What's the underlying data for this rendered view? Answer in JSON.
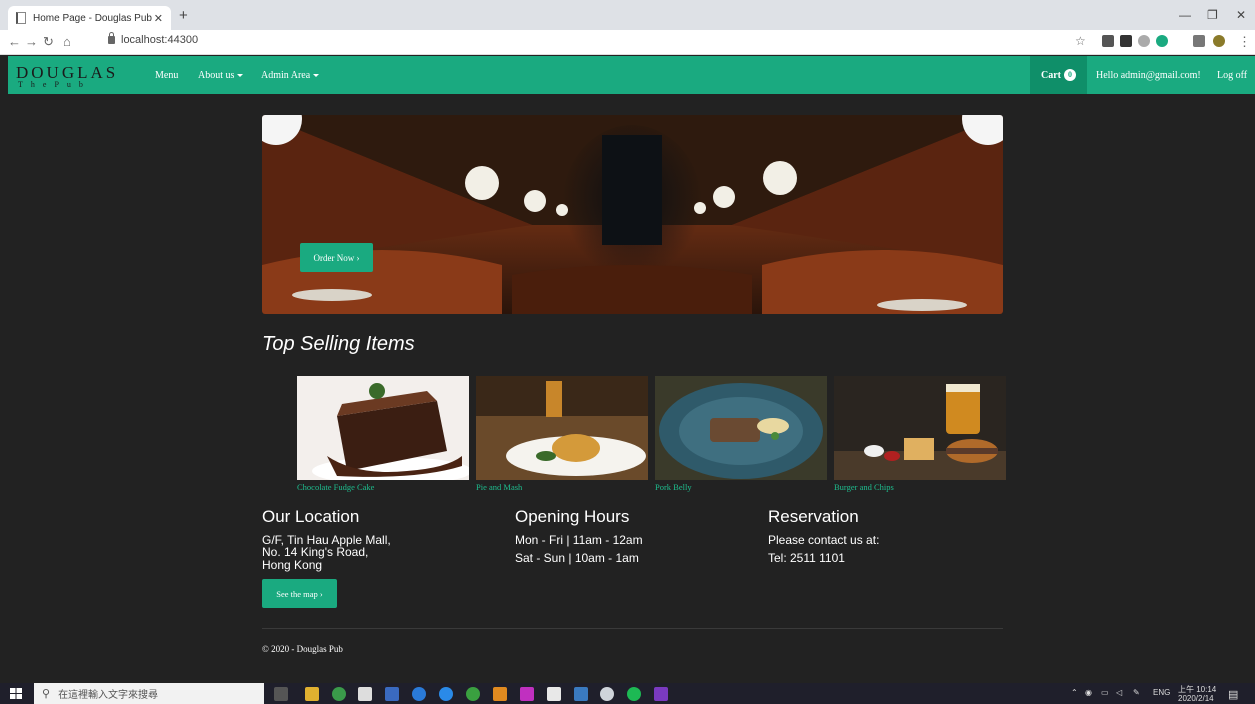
{
  "browser": {
    "tab_title": "Home Page - Douglas Pub",
    "url": "localhost:44300"
  },
  "navbar": {
    "brand_top": "DOUGLAS",
    "brand_sub": "ThePub",
    "menu": "Menu",
    "about": "About us",
    "admin": "Admin Area",
    "cart": "Cart",
    "cart_count": "0",
    "hello": "Hello admin@gmail.com!",
    "logoff": "Log off"
  },
  "hero": {
    "order_button": "Order Now ›"
  },
  "top_selling": {
    "title": "Top Selling Items",
    "items": [
      {
        "name": "Chocolate Fudge Cake"
      },
      {
        "name": "Pie and Mash"
      },
      {
        "name": "Pork Belly"
      },
      {
        "name": "Burger and Chips"
      }
    ]
  },
  "location": {
    "title": "Our Location",
    "line1": "G/F, Tin Hau Apple Mall,",
    "line2": "No. 14 King's Road,",
    "line3": "Hong Kong",
    "button": "See the map ›"
  },
  "hours": {
    "title": "Opening Hours",
    "line1": "Mon - Fri | 11am - 12am",
    "line2": "Sat - Sun | 10am - 1am"
  },
  "reservation": {
    "title": "Reservation",
    "line1": "Please contact us at:",
    "line2": "Tel: 2511 1101"
  },
  "footer": {
    "copyright": "© 2020 - Douglas Pub"
  },
  "taskbar": {
    "search_placeholder": "在這裡輸入文字來搜尋",
    "lang": "ENG",
    "time": "上午 10:14",
    "date": "2020/2/14"
  }
}
